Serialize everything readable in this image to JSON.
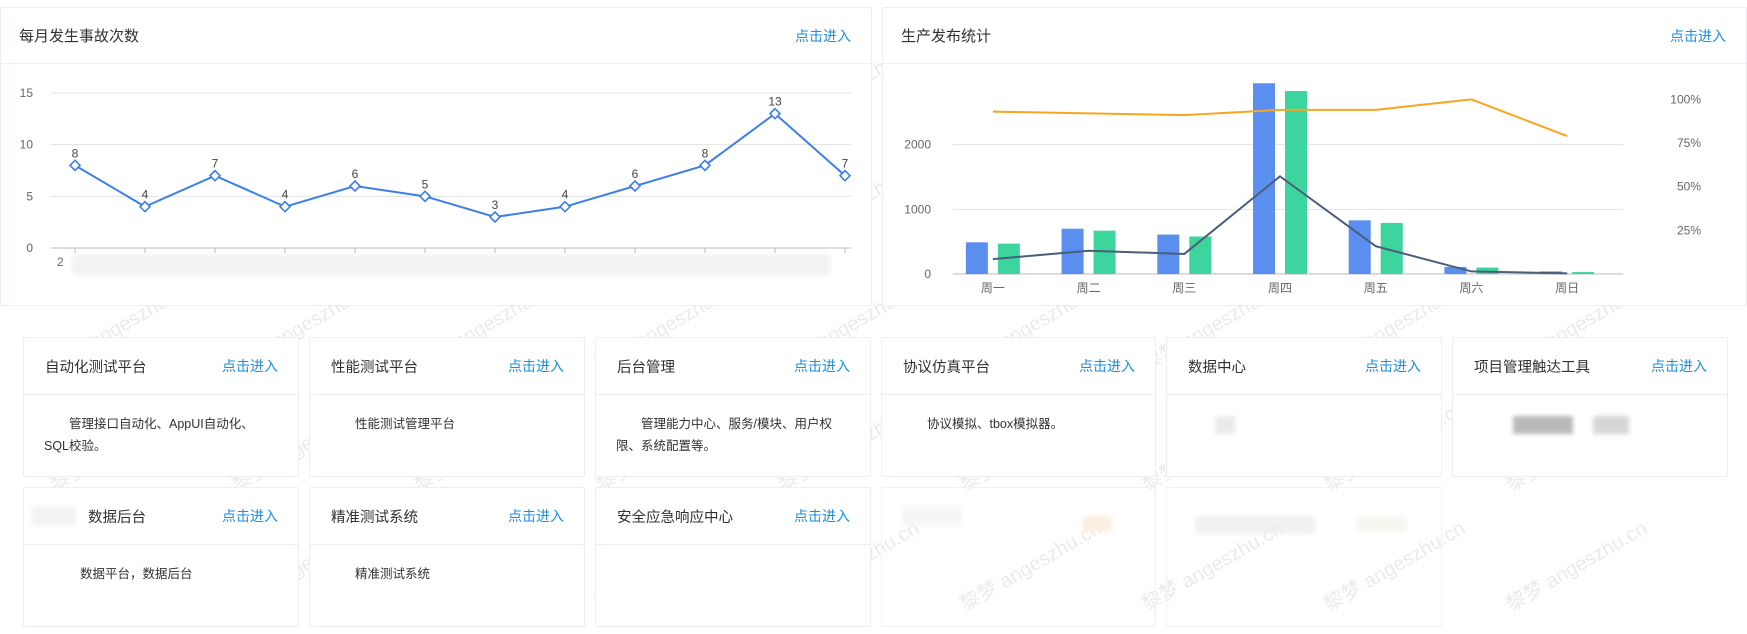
{
  "enter_label": "点击进入",
  "accidents_panel": {
    "title": "每月发生事故次数",
    "enter": "点击进入"
  },
  "release_panel": {
    "title": "生产发布统计",
    "enter": "点击进入"
  },
  "cards": [
    {
      "title": "自动化测试平台",
      "enter": "点击进入",
      "desc": "管理接口自动化、AppUI自动化、SQL校验。"
    },
    {
      "title": "性能测试平台",
      "enter": "点击进入",
      "desc": "性能测试管理平台"
    },
    {
      "title": "后台管理",
      "enter": "点击进入",
      "desc": "管理能力中心、服务/模块、用户权限、系统配置等。"
    },
    {
      "title": "协议仿真平台",
      "enter": "点击进入",
      "desc": "协议模拟、tbox模拟器。"
    },
    {
      "title": "数据中心",
      "enter": "点击进入",
      "desc": ""
    },
    {
      "title": "项目管理触达工具",
      "enter": "点击进入",
      "desc": ""
    },
    {
      "title": "数据后台",
      "enter": "点击进入",
      "desc": "数据平台，数据后台"
    },
    {
      "title": "精准测试系统",
      "enter": "点击进入",
      "desc": "精准测试系统"
    },
    {
      "title": "安全应急响应中心",
      "enter": "点击进入",
      "desc": ""
    }
  ],
  "watermark": "黎梦 angeszhu.cn",
  "colors": {
    "accent_link": "#1a8fe3",
    "line_blue": "#3d7fe8",
    "bar_blue": "#5a8ff0",
    "bar_green": "#3dd59e",
    "line_orange": "#f5a623",
    "line_dark": "#4a5e7a"
  },
  "chart_data": [
    {
      "type": "line",
      "title": "每月发生事故次数",
      "x_first_tick": "2",
      "values": [
        8,
        4,
        7,
        4,
        6,
        5,
        3,
        4,
        6,
        8,
        13,
        7
      ],
      "data_labels": [
        "8",
        "4",
        "7",
        "4",
        "6",
        "5",
        "3",
        "4",
        "6",
        "8",
        "13",
        "7"
      ],
      "y_ticks": [
        "0",
        "5",
        "10",
        "15"
      ],
      "ylim": [
        0,
        15
      ],
      "marker": "diamond",
      "grid": true
    },
    {
      "type": "bar",
      "title": "生产发布统计",
      "categories": [
        "周一",
        "周二",
        "周三",
        "周四",
        "周五",
        "周六",
        "周日"
      ],
      "series": [
        {
          "values": [
            490,
            700,
            610,
            2950,
            830,
            110,
            40
          ],
          "kind": "bar",
          "color": "#5a8ff0",
          "axis": "left"
        },
        {
          "values": [
            470,
            670,
            580,
            2830,
            790,
            100,
            30
          ],
          "kind": "bar",
          "color": "#3dd59e",
          "axis": "left"
        },
        {
          "values": [
            93,
            92,
            91,
            94,
            94,
            100,
            79
          ],
          "kind": "line",
          "color": "#f5a623",
          "axis": "right"
        },
        {
          "values": [
            230,
            360,
            310,
            1510,
            430,
            40,
            10
          ],
          "kind": "line",
          "color": "#4a5e7a",
          "axis": "left"
        }
      ],
      "y_left_ticks": [
        "0",
        "1000",
        "2000"
      ],
      "y_left_lim": [
        0,
        3000
      ],
      "y_right_ticks": [
        "25%",
        "50%",
        "75%",
        "100%"
      ],
      "y_right_lim": [
        0,
        100
      ],
      "grid": true
    }
  ]
}
